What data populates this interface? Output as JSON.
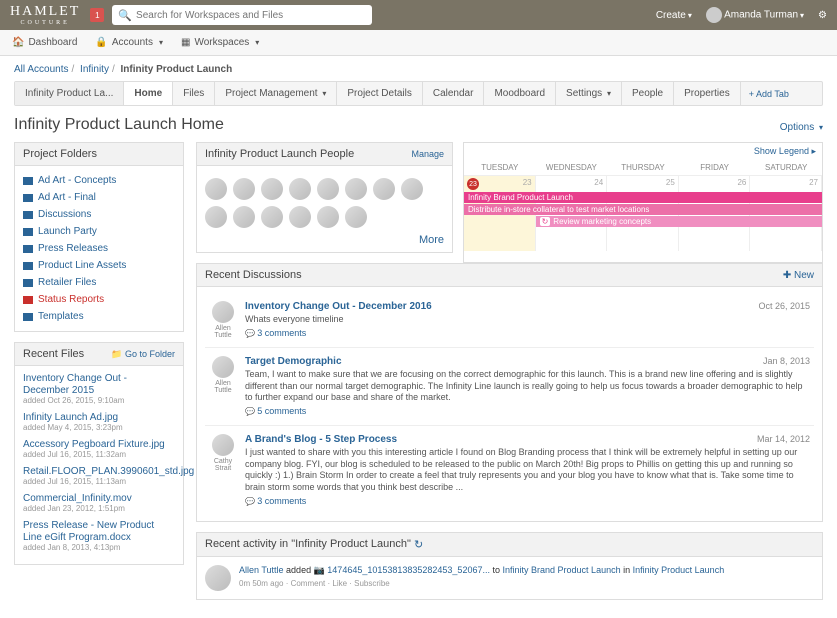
{
  "top": {
    "brand": "HAMLET",
    "brand_sub": "COUTURE",
    "notif_count": "1",
    "search_placeholder": "Search for Workspaces and Files",
    "create": "Create",
    "user": "Amanda Turman"
  },
  "nav": {
    "dashboard": "Dashboard",
    "accounts": "Accounts",
    "workspaces": "Workspaces"
  },
  "breadcrumb": {
    "all": "All Accounts",
    "acct": "Infinity",
    "cur": "Infinity Product Launch"
  },
  "tabs": {
    "name": "Infinity Product La...",
    "items": [
      "Home",
      "Files",
      "Project Management",
      "Project Details",
      "Calendar",
      "Moodboard",
      "Settings",
      "People",
      "Properties"
    ],
    "add": "+ Add Tab"
  },
  "page_title": "Infinity Product Launch Home",
  "options": "Options",
  "folders": {
    "header": "Project Folders",
    "items": [
      {
        "label": "Ad Art - Concepts"
      },
      {
        "label": "Ad Art - Final"
      },
      {
        "label": "Discussions"
      },
      {
        "label": "Launch Party"
      },
      {
        "label": "Press Releases"
      },
      {
        "label": "Product Line Assets"
      },
      {
        "label": "Retailer Files"
      },
      {
        "label": "Status Reports",
        "red": true
      },
      {
        "label": "Templates"
      }
    ]
  },
  "recent_files": {
    "header": "Recent Files",
    "goto": "Go to Folder",
    "items": [
      {
        "t": "Inventory Change Out - December 2015",
        "m": "added Oct 26, 2015, 9:10am"
      },
      {
        "t": "Infinity Launch Ad.jpg",
        "m": "added May 4, 2015, 3:23pm"
      },
      {
        "t": "Accessory Pegboard Fixture.jpg",
        "m": "added Jul 16, 2015, 11:32am"
      },
      {
        "t": "Retail.FLOOR_PLAN.3990601_std.jpg",
        "m": "added Jul 16, 2015, 11:13am"
      },
      {
        "t": "Commercial_Infinity.mov",
        "m": "added Jan 23, 2012, 1:51pm"
      },
      {
        "t": "Press Release - New Product Line eGift Program.docx",
        "m": "added Jan 8, 2013, 4:13pm"
      }
    ]
  },
  "people": {
    "header": "Infinity Product Launch People",
    "manage": "Manage",
    "more": "More"
  },
  "calendar": {
    "legend": "Show Legend",
    "days": [
      "TUESDAY",
      "WEDNESDAY",
      "THURSDAY",
      "FRIDAY",
      "SATURDAY"
    ],
    "nums": [
      "23",
      "24",
      "25",
      "26",
      "27"
    ],
    "events": [
      "Infinity Brand Product Launch",
      "Distribute in-store collateral to test market locations",
      "Review marketing concepts"
    ]
  },
  "discussions": {
    "header": "Recent Discussions",
    "new": "New",
    "items": [
      {
        "who": "Allen Tuttle",
        "title": "Inventory Change Out - December 2016",
        "date": "Oct 26, 2015",
        "txt": "Whats everyone timeline",
        "c": "3 comments"
      },
      {
        "who": "Allen Tuttle",
        "title": "Target Demographic",
        "date": "Jan 8, 2013",
        "txt": "Team,  I want to make sure that we are focusing on the correct demographic for this launch. This is a brand new line offering and is slightly different than our normal target demographic. The Infinity Line launch is really going to help us focus towards a broader demographic to help to further expand our base and share of the market.",
        "c": "5 comments"
      },
      {
        "who": "Cathy Strait",
        "title": "A Brand's Blog - 5 Step Process",
        "date": "Mar 14, 2012",
        "txt": "I just wanted to share with you this interesting article I found on Blog Branding process that I think will be extremely helpful in setting up our company blog. FYI, our blog is scheduled to be released to the public on March 20th! Big props to Phillis on getting this up and running so quickly :)  1.) Brain Storm In order to create a feel that truly represents you and your blog you have to know what that is. Take some time to brain storm some words that you think best describe ...",
        "c": "3 comments"
      }
    ]
  },
  "activity": {
    "header": "Recent activity in \"Infinity Product Launch\"",
    "who": "Allen Tuttle",
    "verb": "added",
    "file": "1474645_10153813835282453_52067...",
    "to": "to",
    "loc1": "Infinity Brand Product Launch",
    "in": "in",
    "loc2": "Infinity Product Launch",
    "meta": "0m 50m ago · Comment · Like · Subscribe"
  }
}
